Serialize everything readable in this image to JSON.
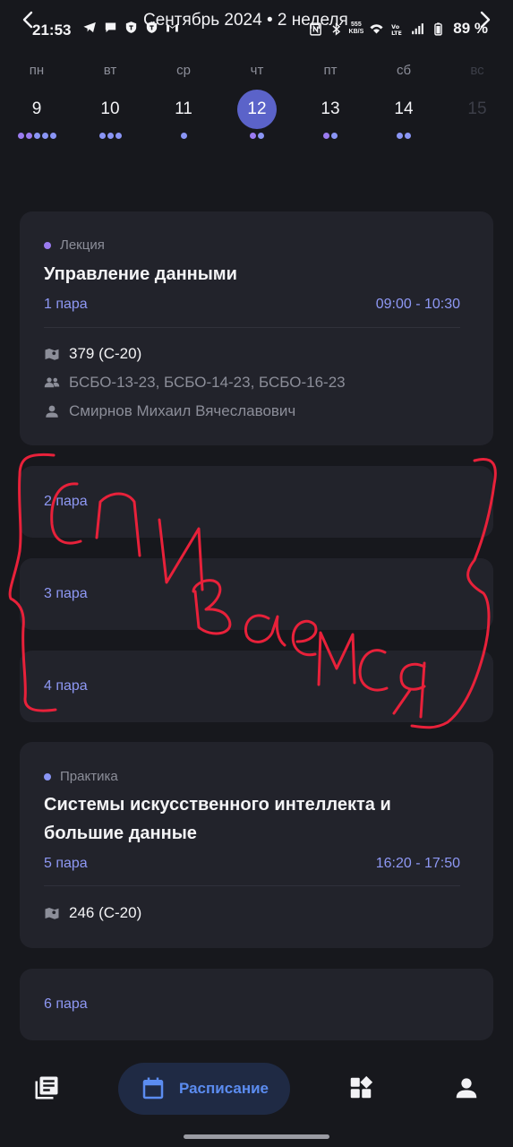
{
  "status_bar": {
    "time": "21:53",
    "battery_percent": "89 %",
    "net_speed_top": "555",
    "net_speed_bottom": "KB/S"
  },
  "header": {
    "month_title": "Сентябрь 2024  • 2 неделя"
  },
  "week": [
    {
      "name": "пн",
      "num": "9",
      "lecture_dots": 1,
      "practice_dots": 4,
      "selected": false,
      "dim": false
    },
    {
      "name": "вт",
      "num": "10",
      "lecture_dots": 0,
      "practice_dots": 3,
      "selected": false,
      "dim": false
    },
    {
      "name": "ср",
      "num": "11",
      "lecture_dots": 0,
      "practice_dots": 1,
      "selected": false,
      "dim": false
    },
    {
      "name": "чт",
      "num": "12",
      "lecture_dots": 1,
      "practice_dots": 1,
      "selected": true,
      "dim": false
    },
    {
      "name": "пт",
      "num": "13",
      "lecture_dots": 1,
      "practice_dots": 1,
      "selected": false,
      "dim": false
    },
    {
      "name": "сб",
      "num": "14",
      "lecture_dots": 0,
      "practice_dots": 2,
      "selected": false,
      "dim": false
    },
    {
      "name": "вс",
      "num": "15",
      "lecture_dots": 0,
      "practice_dots": 0,
      "selected": false,
      "dim": true
    }
  ],
  "lessons": [
    {
      "type": "Лекция",
      "type_color": "#9b7bf0",
      "subject": "Управление данными",
      "pair": "1 пара",
      "time": "09:00 - 10:30",
      "room": "379 (С-20)",
      "groups": "БСБО-13-23, БСБО-14-23, БСБО-16-23",
      "teacher": "Смирнов Михаил Вячеславович"
    },
    {
      "pair": "2 пара"
    },
    {
      "pair": "3 пара"
    },
    {
      "pair": "4 пара"
    },
    {
      "type": "Практика",
      "type_color": "#8a95f5",
      "subject_line1": "Системы искусственного интеллекта и",
      "subject_line2": "большие данные",
      "pair": "5 пара",
      "time": "16:20 - 17:50",
      "room": "246 (С-20)"
    },
    {
      "pair": "6 пара"
    }
  ],
  "bottom_nav": {
    "items": [
      {
        "icon": "book-library-icon"
      },
      {
        "icon": "calendar-icon",
        "label": "Расписание",
        "active": true
      },
      {
        "icon": "apps-grid-icon"
      },
      {
        "icon": "profile-icon"
      }
    ]
  },
  "colors": {
    "background": "#17181d",
    "card": "#22232b",
    "accent": "#8e98f4",
    "selected_day": "#5b63c9",
    "nav_active": "#5b8cf0",
    "annotation": "#e8213a"
  },
  "annotation": {
    "handwritten_text": "спиваемся"
  }
}
